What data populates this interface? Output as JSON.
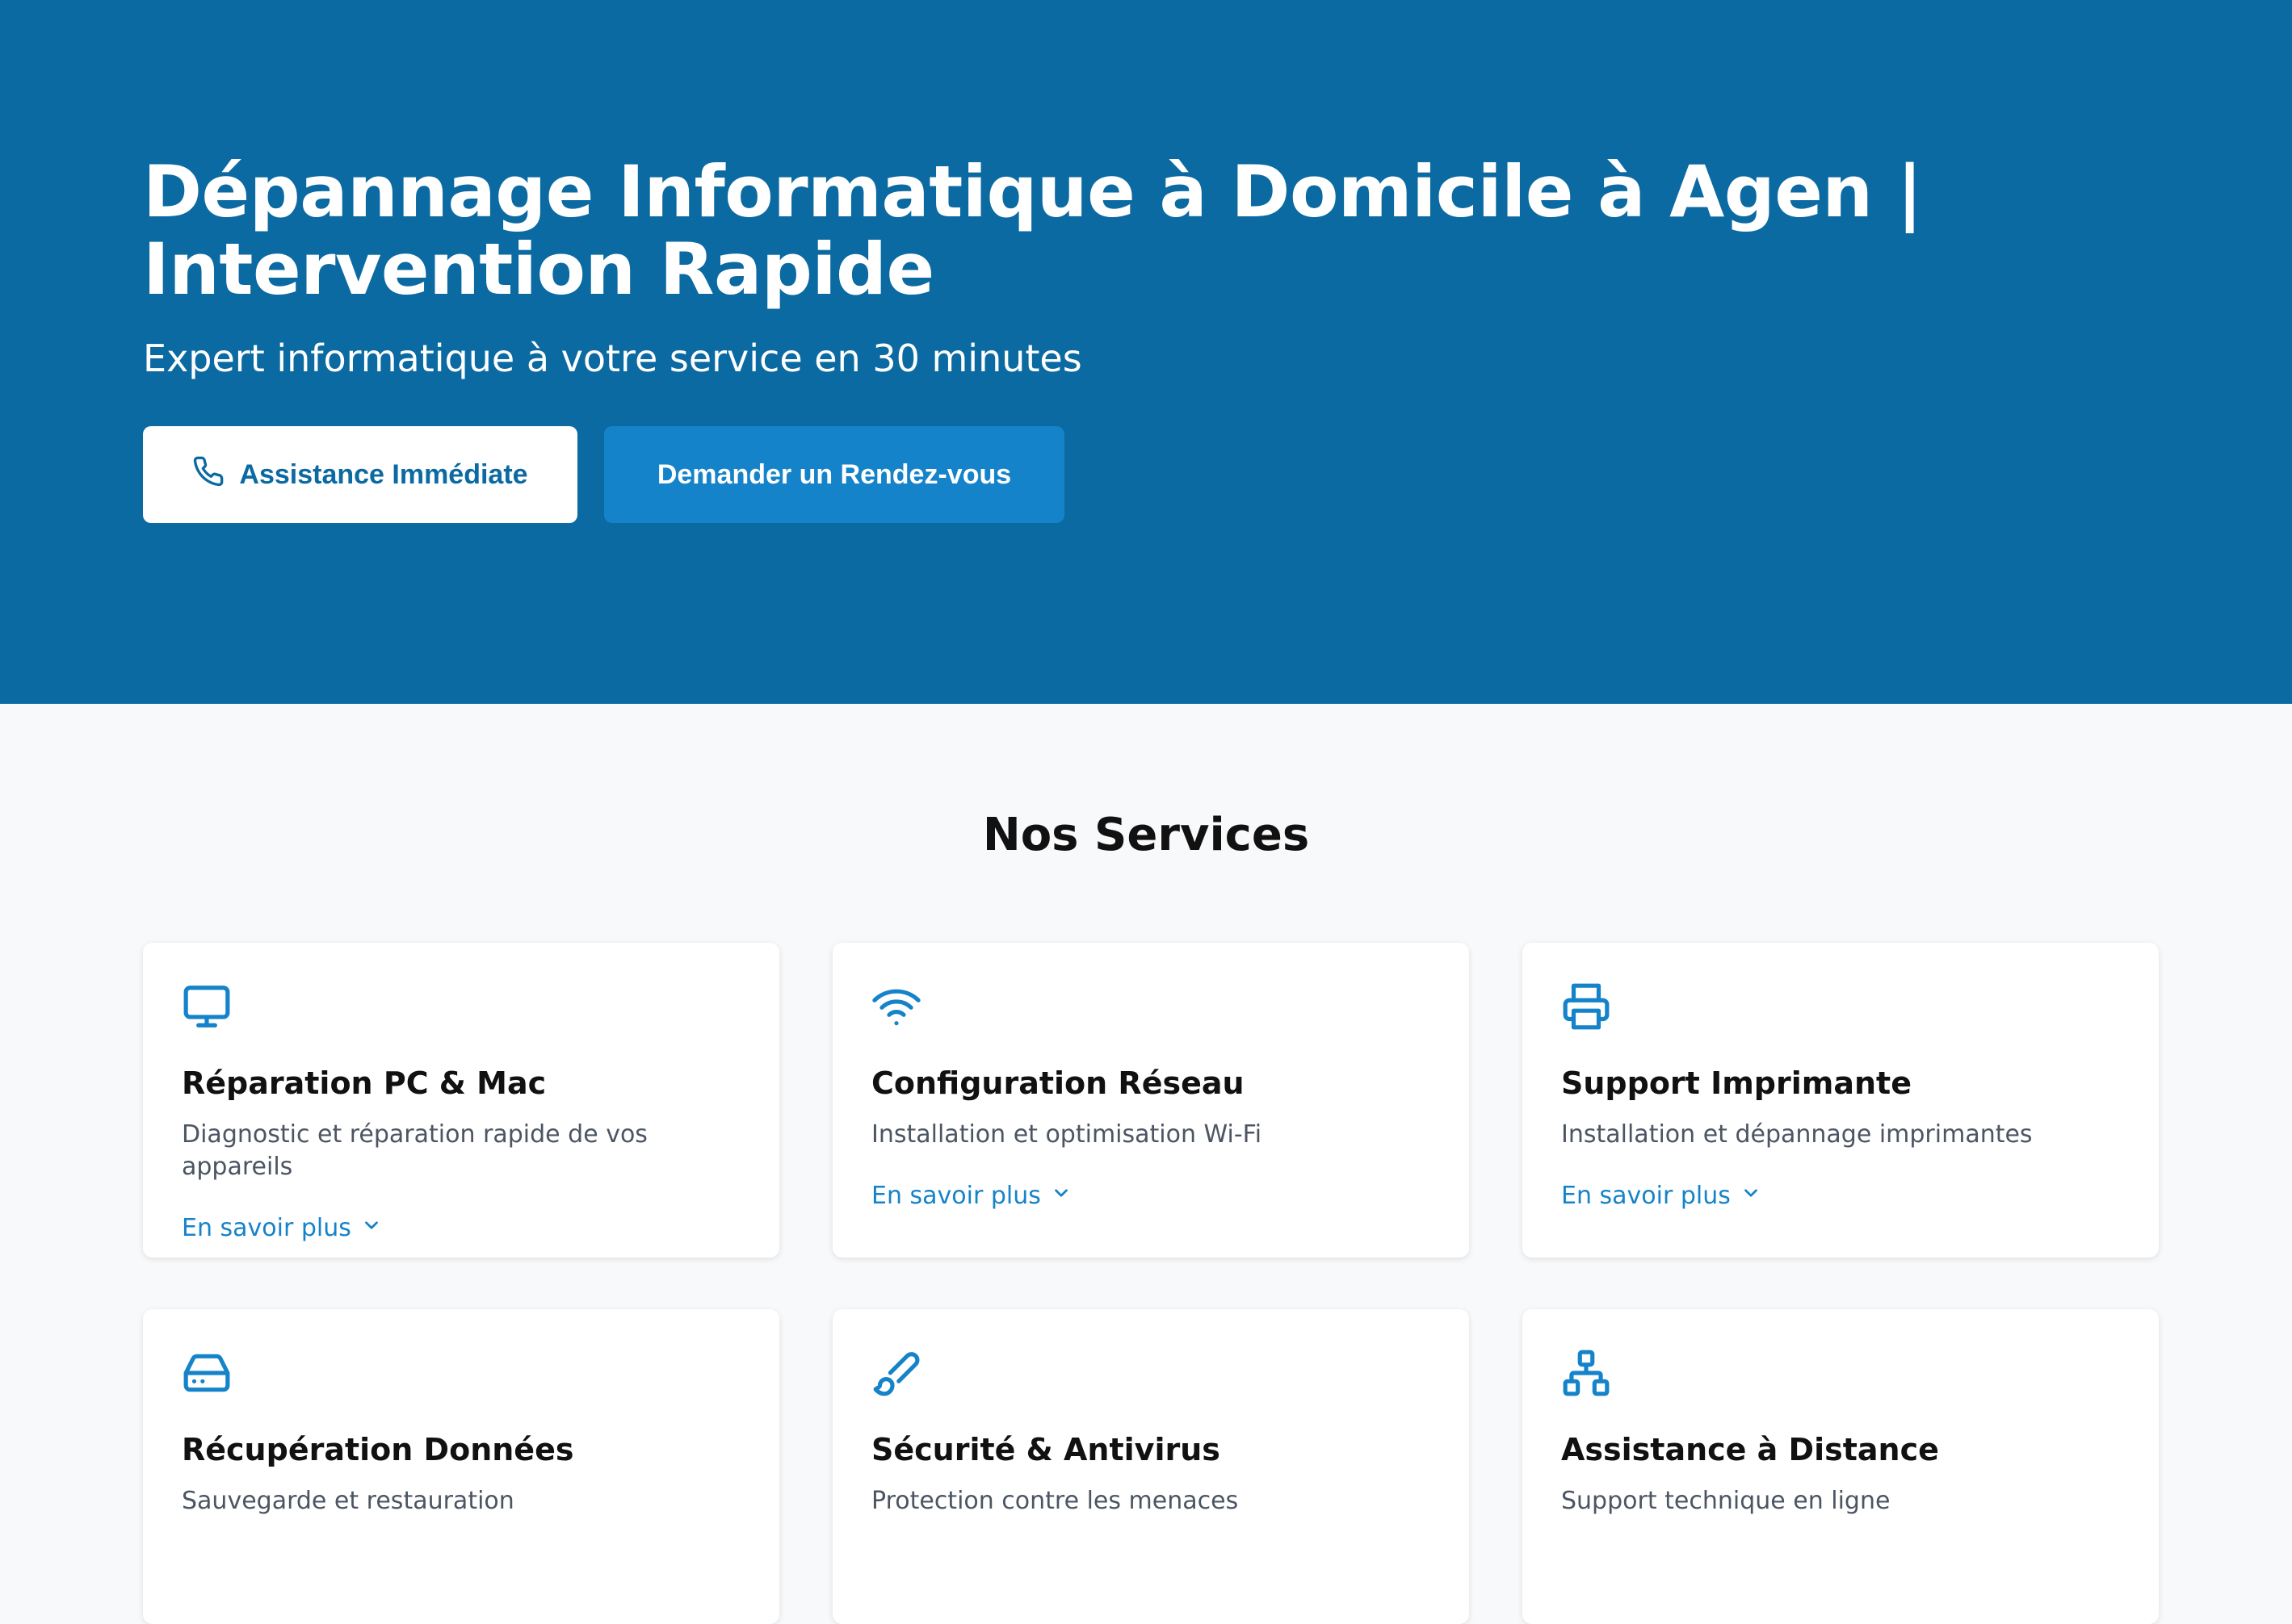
{
  "hero": {
    "title_line1": "Dépannage Informatique à Domicile à Agen |",
    "title_line2": "Intervention Rapide",
    "subtitle": "Expert informatique à votre service en 30 minutes",
    "primary_button": "Assistance Immédiate",
    "secondary_button": "Demander un Rendez-vous"
  },
  "services": {
    "heading": "Nos Services",
    "more_label": "En savoir plus",
    "items": [
      {
        "title": "Réparation PC & Mac",
        "description": "Diagnostic et réparation rapide de vos appareils",
        "icon": "monitor-icon"
      },
      {
        "title": "Configuration Réseau",
        "description": "Installation et optimisation Wi-Fi",
        "icon": "wifi-icon"
      },
      {
        "title": "Support Imprimante",
        "description": "Installation et dépannage imprimantes",
        "icon": "printer-icon"
      },
      {
        "title": "Récupération Données",
        "description": "Sauvegarde et restauration",
        "icon": "hard-drive-icon"
      },
      {
        "title": "Sécurité & Antivirus",
        "description": "Protection contre les menaces",
        "icon": "brush-icon"
      },
      {
        "title": "Assistance à Distance",
        "description": "Support technique en ligne",
        "icon": "network-icon"
      }
    ]
  },
  "colors": {
    "hero_bg": "#0b6aa1",
    "accent": "#1583c9",
    "page_bg": "#f8f9fb"
  }
}
